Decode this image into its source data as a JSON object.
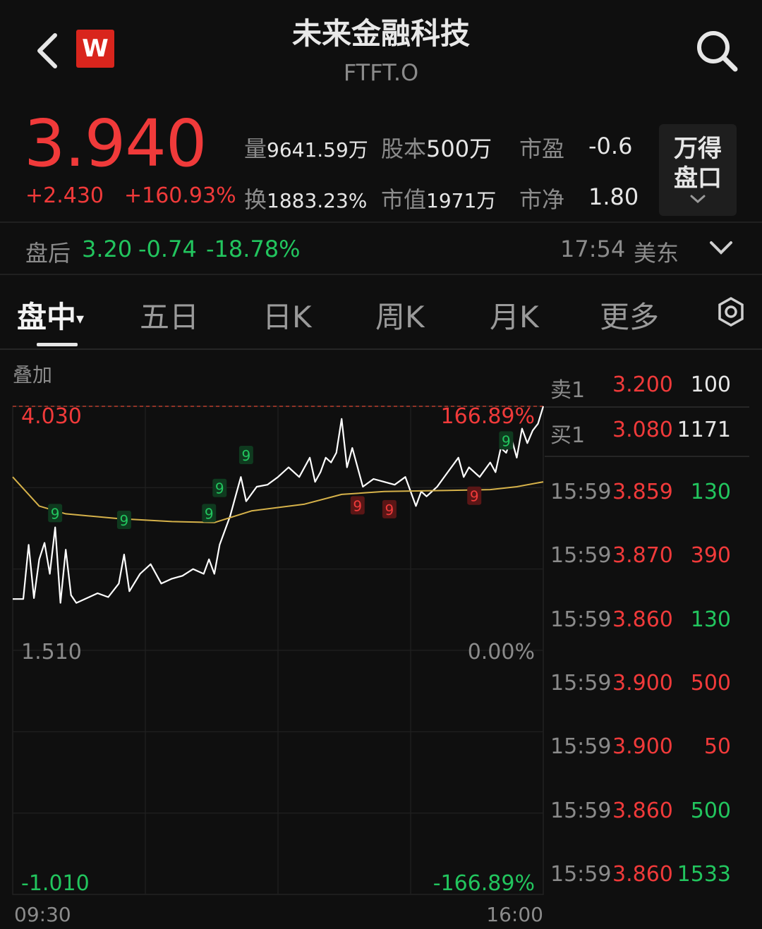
{
  "header": {
    "title": "未来金融科技",
    "ticker": "FTFT.O",
    "logo_text": "W"
  },
  "quote": {
    "price": "3.940",
    "change": "+2.430",
    "change_pct": "+160.93%",
    "volume_label": "量",
    "volume": "9641.59万",
    "share_capital_label": "股本",
    "share_capital": "500万",
    "pe_label": "市盈",
    "pe": "-0.6",
    "turnover_label": "换",
    "turnover": "1883.23%",
    "market_cap_label": "市值",
    "market_cap": "1971万",
    "pb_label": "市净",
    "pb": "1.80",
    "wind_panel_line1": "万得",
    "wind_panel_line2": "盘口"
  },
  "after_hours": {
    "label": "盘后",
    "price": "3.20",
    "change": "-0.74",
    "change_pct": "-18.78%",
    "time": "17:54",
    "zone": "美东"
  },
  "tabs": [
    {
      "label": "盘中"
    },
    {
      "label": "五日"
    },
    {
      "label": "日K"
    },
    {
      "label": "周K"
    },
    {
      "label": "月K"
    },
    {
      "label": "更多"
    }
  ],
  "chart_overlay_label": "叠加",
  "chart_data": {
    "type": "line",
    "title": "",
    "xlabel": "",
    "ylabel": "",
    "x_range": [
      "09:30",
      "16:00"
    ],
    "ylim": [
      -1.01,
      4.03
    ],
    "y_tick_labels_left": [
      "4.030",
      "1.510",
      "-1.010"
    ],
    "y_tick_labels_right": [
      "166.89%",
      "0.00%",
      "-166.89%"
    ],
    "x_tick_labels": [
      "09:30",
      "16:00"
    ],
    "grid": true,
    "series": [
      {
        "color": "#ffffff",
        "x": [
          0,
          0.02,
          0.03,
          0.04,
          0.05,
          0.06,
          0.07,
          0.08,
          0.09,
          0.1,
          0.11,
          0.12,
          0.14,
          0.16,
          0.18,
          0.2,
          0.21,
          0.22,
          0.24,
          0.26,
          0.28,
          0.3,
          0.32,
          0.34,
          0.36,
          0.37,
          0.38,
          0.39,
          0.4,
          0.41,
          0.42,
          0.43,
          0.44,
          0.46,
          0.48,
          0.5,
          0.52,
          0.54,
          0.56,
          0.57,
          0.58,
          0.59,
          0.6,
          0.61,
          0.62,
          0.63,
          0.64,
          0.66,
          0.68,
          0.7,
          0.72,
          0.74,
          0.76,
          0.77,
          0.78,
          0.8,
          0.82,
          0.84,
          0.85,
          0.86,
          0.88,
          0.9,
          0.91,
          0.92,
          0.93,
          0.94,
          0.95,
          0.96,
          0.97,
          0.98,
          0.99,
          1.0
        ],
        "values": [
          2.04,
          2.04,
          2.6,
          2.05,
          2.45,
          2.62,
          2.3,
          2.78,
          2.0,
          2.55,
          2.08,
          2.0,
          2.05,
          2.1,
          2.06,
          2.2,
          2.5,
          2.12,
          2.3,
          2.4,
          2.2,
          2.25,
          2.28,
          2.35,
          2.3,
          2.45,
          2.3,
          2.6,
          2.75,
          2.9,
          3.1,
          3.3,
          3.05,
          3.2,
          3.22,
          3.3,
          3.4,
          3.3,
          3.5,
          3.25,
          3.35,
          3.5,
          3.45,
          3.55,
          3.9,
          3.4,
          3.6,
          3.2,
          3.28,
          3.25,
          3.22,
          3.3,
          3.0,
          3.15,
          3.1,
          3.2,
          3.35,
          3.5,
          3.3,
          3.4,
          3.3,
          3.45,
          3.35,
          3.6,
          3.55,
          3.7,
          3.5,
          3.8,
          3.65,
          3.78,
          3.85,
          4.03
        ]
      },
      {
        "color": "#d6b24a",
        "x": [
          0,
          0.05,
          0.1,
          0.2,
          0.3,
          0.38,
          0.45,
          0.55,
          0.62,
          0.7,
          0.8,
          0.9,
          0.95,
          1.0
        ],
        "values": [
          3.3,
          3.0,
          2.92,
          2.87,
          2.84,
          2.83,
          2.95,
          3.02,
          3.12,
          3.15,
          3.16,
          3.17,
          3.2,
          3.25
        ]
      }
    ],
    "signals": [
      {
        "x": 0.08,
        "value": 2.92,
        "text": "9",
        "kind": "green"
      },
      {
        "x": 0.21,
        "value": 2.85,
        "text": "9",
        "kind": "green"
      },
      {
        "x": 0.37,
        "value": 2.92,
        "text": "9",
        "kind": "green"
      },
      {
        "x": 0.39,
        "value": 3.18,
        "text": "9",
        "kind": "green"
      },
      {
        "x": 0.44,
        "value": 3.52,
        "text": "9",
        "kind": "green"
      },
      {
        "x": 0.65,
        "value": 3.0,
        "text": "9",
        "kind": "red"
      },
      {
        "x": 0.71,
        "value": 2.96,
        "text": "9",
        "kind": "red"
      },
      {
        "x": 0.87,
        "value": 3.1,
        "text": "9",
        "kind": "red"
      },
      {
        "x": 0.93,
        "value": 3.67,
        "text": "9",
        "kind": "green"
      }
    ]
  },
  "order_book": {
    "asks": [
      {
        "label": "卖1",
        "price": "3.200",
        "qty": "100"
      }
    ],
    "bids": [
      {
        "label": "买1",
        "price": "3.080",
        "qty": "1171"
      }
    ],
    "trades": [
      {
        "time": "15:59",
        "price": "3.859",
        "qty": "130",
        "side": "green"
      },
      {
        "time": "15:59",
        "price": "3.870",
        "qty": "390",
        "side": "red"
      },
      {
        "time": "15:59",
        "price": "3.860",
        "qty": "130",
        "side": "green"
      },
      {
        "time": "15:59",
        "price": "3.900",
        "qty": "500",
        "side": "red"
      },
      {
        "time": "15:59",
        "price": "3.900",
        "qty": "50",
        "side": "red"
      },
      {
        "time": "15:59",
        "price": "3.860",
        "qty": "500",
        "side": "green"
      },
      {
        "time": "15:59",
        "price": "3.860",
        "qty": "1533",
        "side": "green"
      }
    ]
  },
  "colors": {
    "up": "#f03a3a",
    "down": "#22c55e",
    "avg_line": "#d6b24a",
    "background": "#0f0f0f"
  }
}
